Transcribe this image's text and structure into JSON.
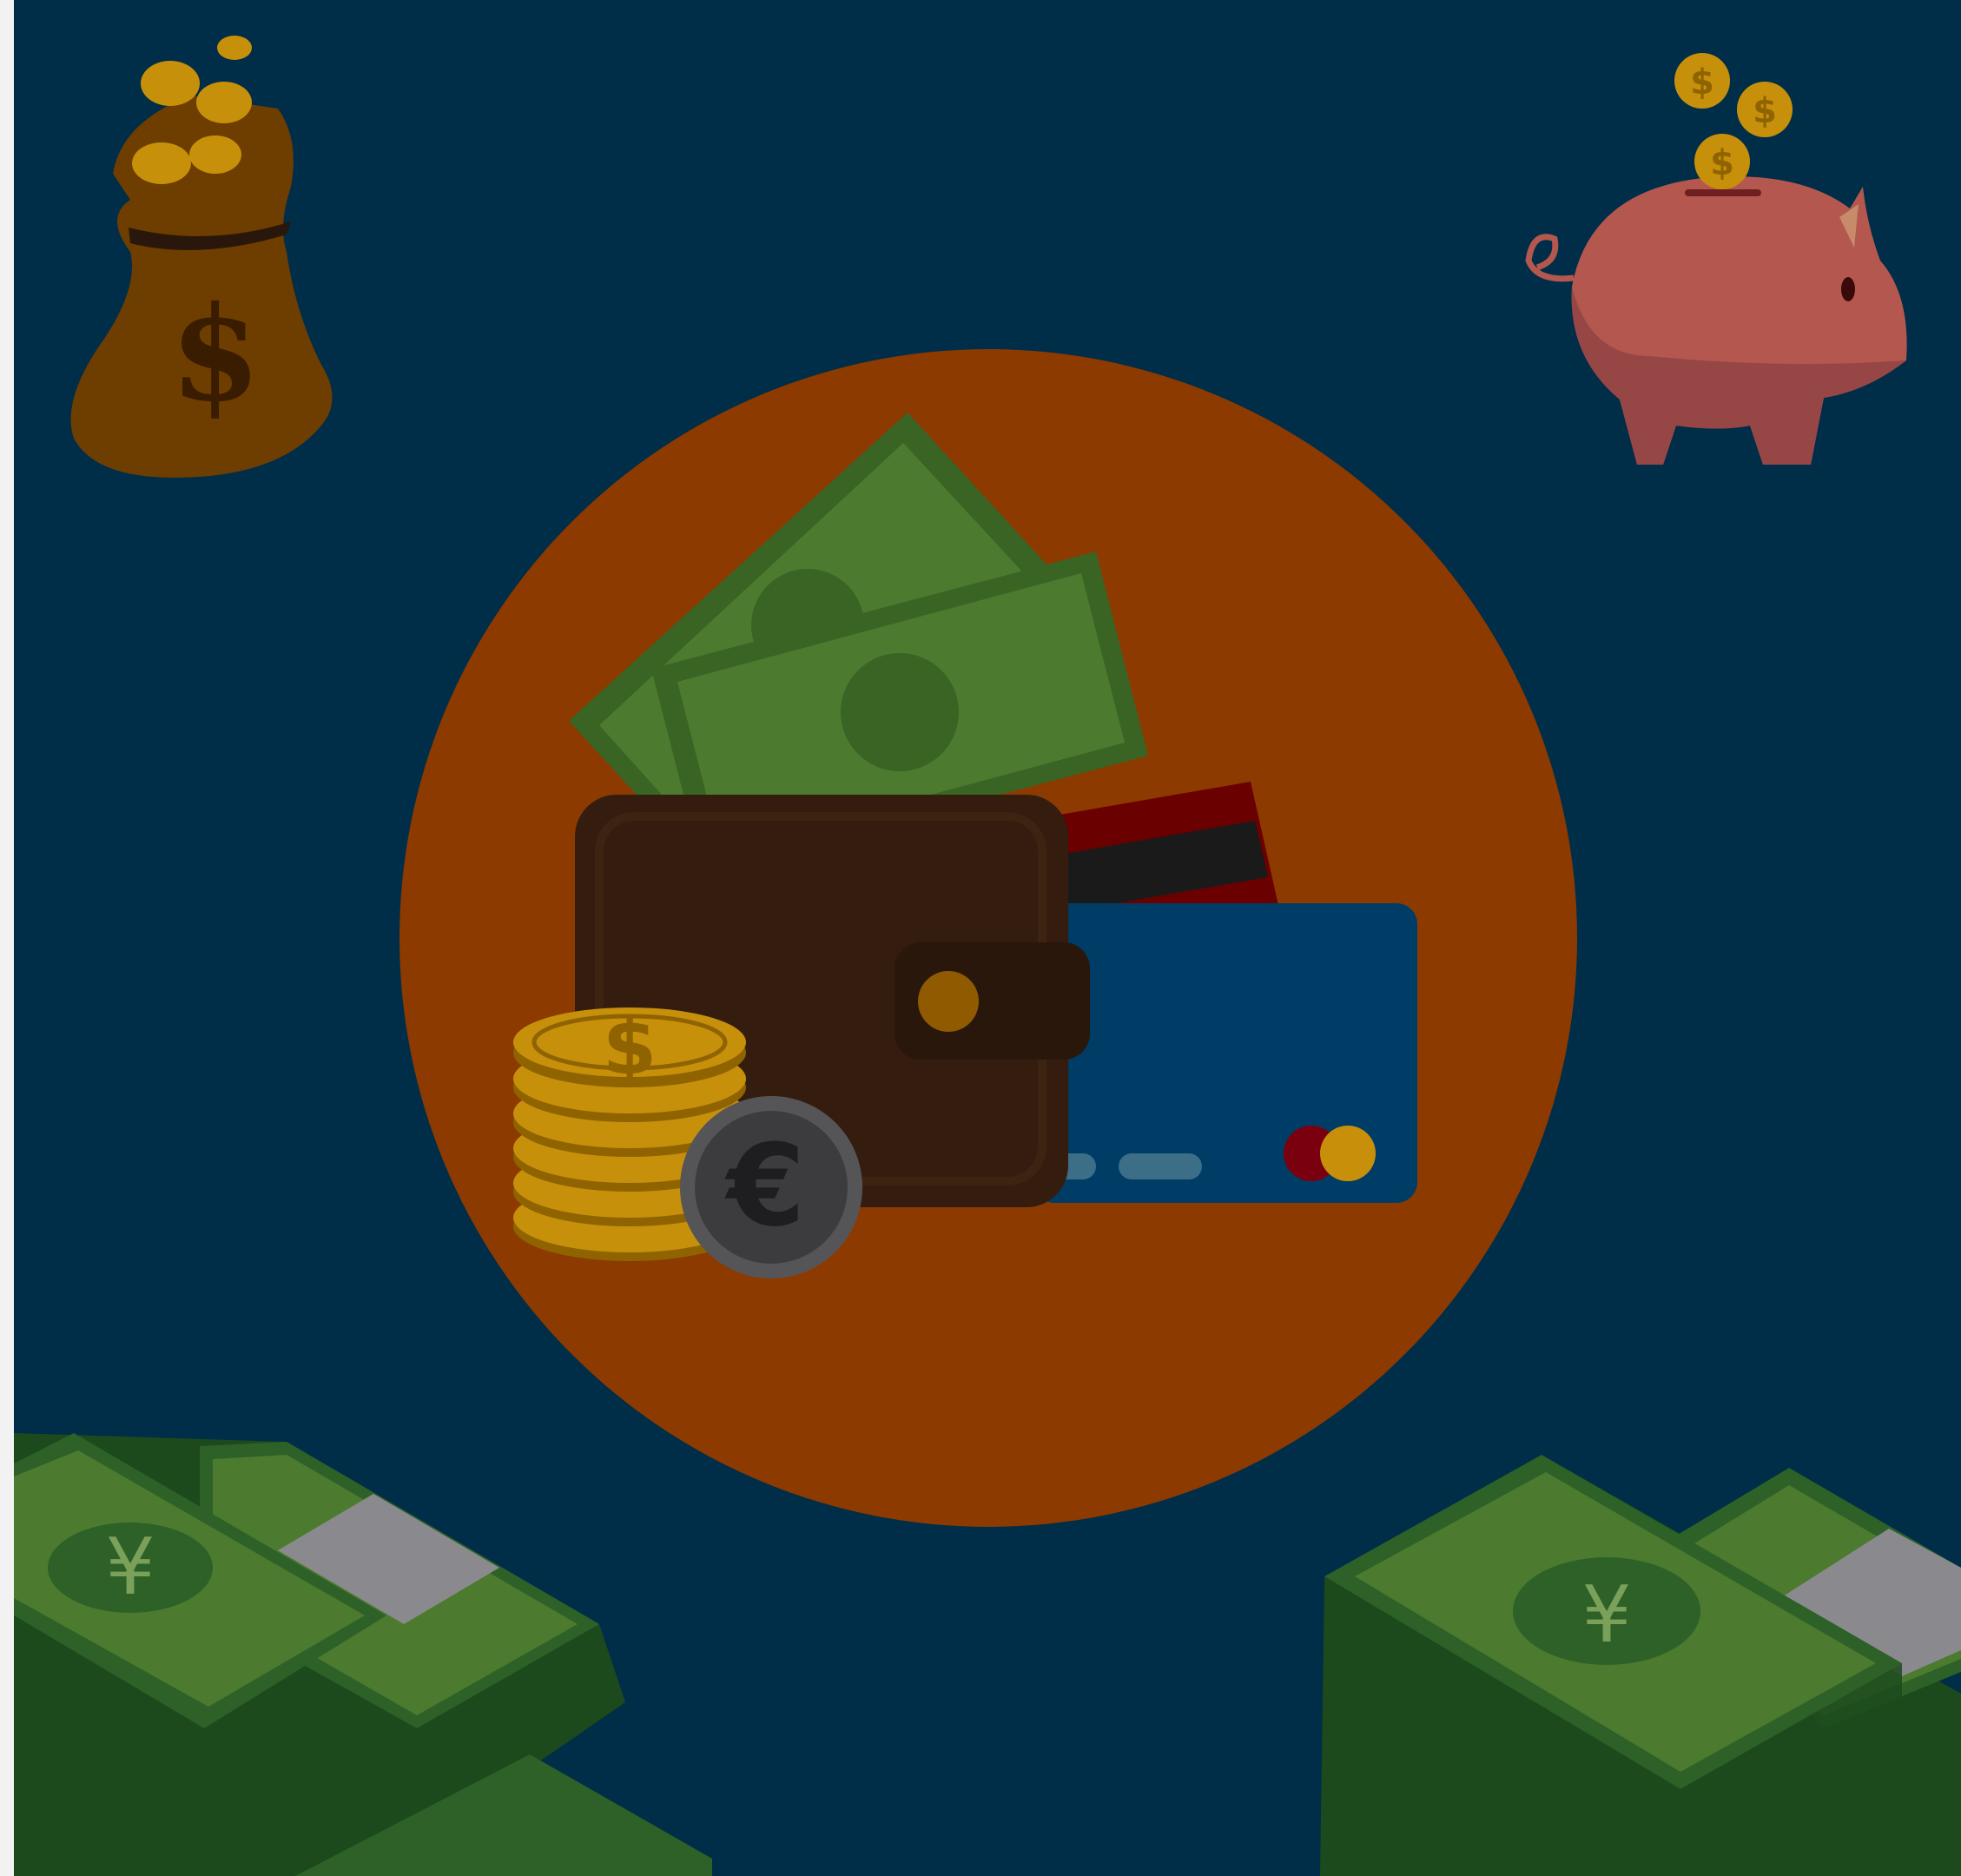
{
  "colors": {
    "background": "#002d48",
    "left_edge": "#f2f2f2",
    "circle": "#8c3a00",
    "wallet": "#341d0e",
    "wallet_dark": "#2a170b",
    "card_blue": "#003d66",
    "card_red": "#6a0000",
    "card_stripe": "#1a1a1a",
    "bill_green": "#4c7a2e",
    "bill_dark": "#3a6424",
    "stack_green": "#2d6128",
    "stack_dark": "#1c4a1c",
    "band_gray": "#8a8a8e",
    "coin_gold": "#c7900a",
    "coin_dark": "#8f6300",
    "euro_coin": "#3c3c3e",
    "money_bag": "#6e3d00",
    "piggy": "#974646",
    "piggy_light": "#b4574f"
  },
  "symbols": {
    "dollar": "$",
    "euro": "€",
    "yen": "¥"
  },
  "icons": [
    "money-bag-icon",
    "piggy-bank-icon",
    "wallet-icon",
    "banknote-icon",
    "credit-card-icon",
    "coin-stack-icon",
    "euro-coin-icon",
    "yen-money-stack-icon"
  ]
}
